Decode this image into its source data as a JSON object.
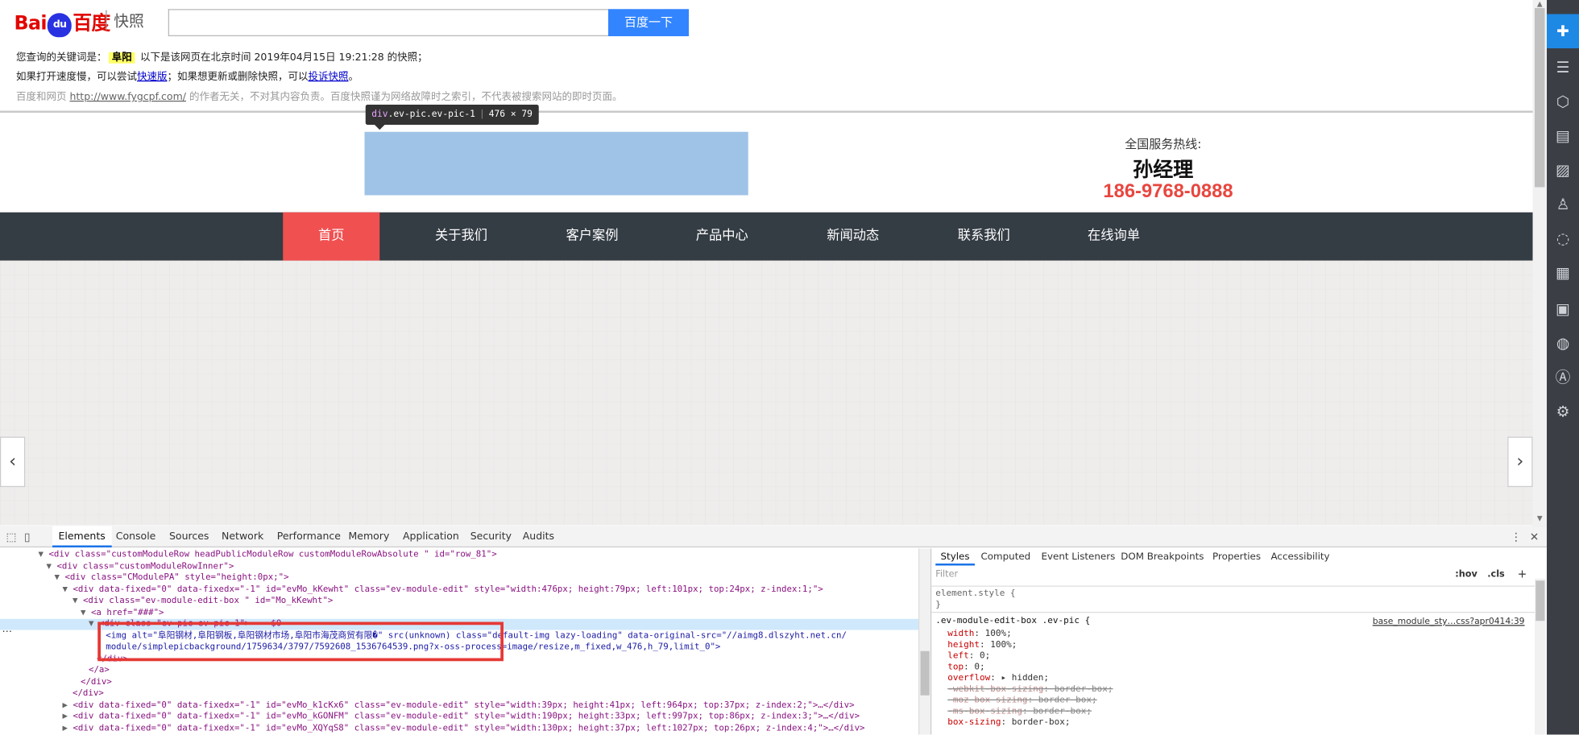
{
  "baidu": {
    "logo_text_1": "Bai",
    "logo_paw": "du",
    "logo_text_2": "百度",
    "kuaizhao": "快照",
    "search_value": "",
    "search_button": "百度一下",
    "line1_prefix": "您查询的关键词是：",
    "keyword": "阜阳",
    "line1_suffix": "以下是该网页在北京时间 2019年04月15日 19:21:28 的快照；",
    "line2_prefix": "如果打开速度慢，可以尝试",
    "line2_link1": "快速版",
    "line2_mid": "；如果想更新或删除快照，可以",
    "line2_link2": "投诉快照",
    "line2_end": "。",
    "line3_prefix": "百度和网页",
    "line3_url": "http://www.fygcpf.com/",
    "line3_suffix": "的作者无关，不对其内容负责。百度快照谨为网络故障时之索引，不代表被搜索网站的即时页面。"
  },
  "inspect_tooltip": {
    "tag": "div",
    "classes": ".ev-pic.ev-pic-1",
    "size": "476 × 79"
  },
  "site": {
    "hotline_label": "全国服务热线:",
    "contact_name": "孙经理",
    "phone": "186-9768-0888",
    "nav": [
      "首页",
      "关于我们",
      "客户案例",
      "产品中心",
      "新闻动态",
      "联系我们",
      "在线询单"
    ],
    "prev_arrow": "‹",
    "next_arrow": "›"
  },
  "side_icons": [
    "plus-cross-icon",
    "list-icon",
    "cube-icon",
    "document-icon",
    "image-icon",
    "user-icon",
    "chat-icon",
    "grid-icon",
    "news-icon",
    "wechat-icon",
    "font-icon",
    "settings-icon"
  ],
  "devtools": {
    "tabs": [
      "Elements",
      "Console",
      "Sources",
      "Network",
      "Performance",
      "Memory",
      "Application",
      "Security",
      "Audits"
    ],
    "active_tab": "Elements",
    "dom_lines": [
      {
        "tri": "▼",
        "text": "<div class=\"customModuleRow headPublicModuleRow customModuleRowAbsolute \" id=\"row_81\">"
      },
      {
        "tri": "▼",
        "text": "<div class=\"customModuleRowInner\">"
      },
      {
        "tri": "▼",
        "text": "<div class=\"CModulePA\" style=\"height:0px;\">"
      },
      {
        "tri": "▼",
        "text": "<div data-fixed=\"0\" data-fixedx=\"-1\" id=\"evMo_kKewht\" class=\"ev-module-edit\" style=\"width:476px; height:79px; left:101px; top:24px; z-index:1;\">"
      },
      {
        "tri": "▼",
        "text": "<div class=\"ev-module-edit-box \" id=\"Mo_kKewht\">"
      },
      {
        "tri": "▼",
        "text": "<a href=\"###\">"
      },
      {
        "tri": "▼",
        "text": "<div class=\"ev-pic ev-pic-1\"> == $0"
      },
      {
        "tri": "",
        "text": "<img alt=\"阜阳钢材,阜阳钢板,阜阳钢材市场,阜阳市海茂商贸有限�\" src(unknown) class=\"default-img lazy-loading\" data-original-src=\"//aimg8.dlszyht.net.cn/"
      },
      {
        "tri": "",
        "text": "module/simplepicbackground/1759634/3797/7592608_1536764539.png?x-oss-process=image/resize,m_fixed,w_476,h_79,limit_0\">"
      },
      {
        "tri": "",
        "text": "</div>"
      },
      {
        "tri": "",
        "text": "</a>"
      },
      {
        "tri": "",
        "text": "</div>"
      },
      {
        "tri": "",
        "text": "</div>"
      },
      {
        "tri": "▶",
        "text": "<div data-fixed=\"0\" data-fixedx=\"-1\" id=\"evMo_k1cKx6\" class=\"ev-module-edit\" style=\"width:39px; height:41px; left:964px; top:37px; z-index:2;\">…</div>"
      },
      {
        "tri": "▶",
        "text": "<div data-fixed=\"0\" data-fixedx=\"-1\" id=\"evMo_kGONFM\" class=\"ev-module-edit\" style=\"width:190px; height:33px; left:997px; top:86px; z-index:3;\">…</div>"
      },
      {
        "tri": "▶",
        "text": "<div data-fixed=\"0\" data-fixedx=\"-1\" id=\"evMo_XQYqS8\" class=\"ev-module-edit\" style=\"width:130px; height:37px; left:1027px; top:26px; z-index:4;\">…</div>"
      }
    ],
    "styles_tabs": [
      "Styles",
      "Computed",
      "Event Listeners",
      "DOM Breakpoints",
      "Properties",
      "Accessibility"
    ],
    "filter_placeholder": "Filter",
    "hov": ":hov",
    "cls": ".cls",
    "plus": "+",
    "element_style_open": "element.style {",
    "element_style_close": "}",
    "rule_selector": ".ev-module-edit-box .ev-pic {",
    "rule_link": "base_module_sty…css?apr0414:39",
    "rule_props": [
      {
        "name": "width",
        "value": "100%;",
        "struck": false
      },
      {
        "name": "height",
        "value": "100%;",
        "struck": false
      },
      {
        "name": "left",
        "value": "0;",
        "struck": false
      },
      {
        "name": "top",
        "value": "0;",
        "struck": false
      },
      {
        "name": "overflow",
        "value": "▸ hidden;",
        "struck": false
      },
      {
        "name": "-webkit-box-sizing",
        "value": "border-box;",
        "struck": true
      },
      {
        "name": "-moz-box-sizing",
        "value": "border-box;",
        "struck": true
      },
      {
        "name": "-ms-box-sizing",
        "value": "border-box;",
        "struck": true
      },
      {
        "name": "box-sizing",
        "value": "border-box;",
        "struck": false
      }
    ]
  }
}
